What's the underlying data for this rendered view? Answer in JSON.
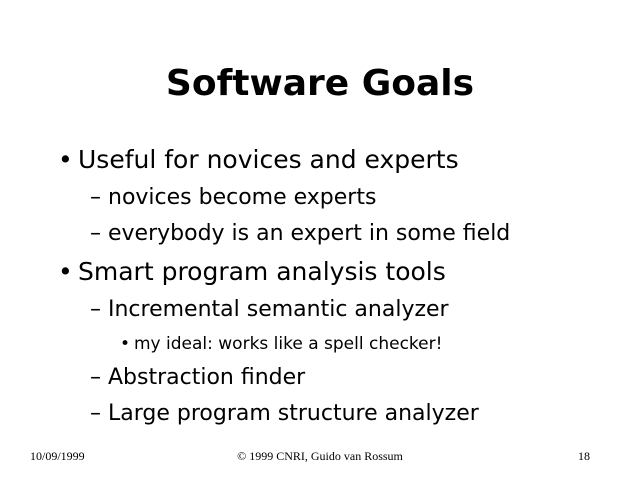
{
  "slide": {
    "title": "Software Goals",
    "bullets": [
      {
        "marker": "•",
        "text": "Useful for novices and experts"
      },
      {
        "marker": "–",
        "text": "novices become experts"
      },
      {
        "marker": "–",
        "text": "everybody is an expert in some field"
      },
      {
        "marker": "•",
        "text": "Smart program analysis tools"
      },
      {
        "marker": "–",
        "text": "Incremental semantic analyzer"
      },
      {
        "marker": "•",
        "text": "my ideal: works like a spell checker!"
      },
      {
        "marker": "–",
        "text": "Abstraction finder"
      },
      {
        "marker": "–",
        "text": "Large program structure analyzer"
      }
    ]
  },
  "footer": {
    "date": "10/09/1999",
    "copyright": "© 1999 CNRI, Guido van Rossum",
    "page_number": "18"
  }
}
